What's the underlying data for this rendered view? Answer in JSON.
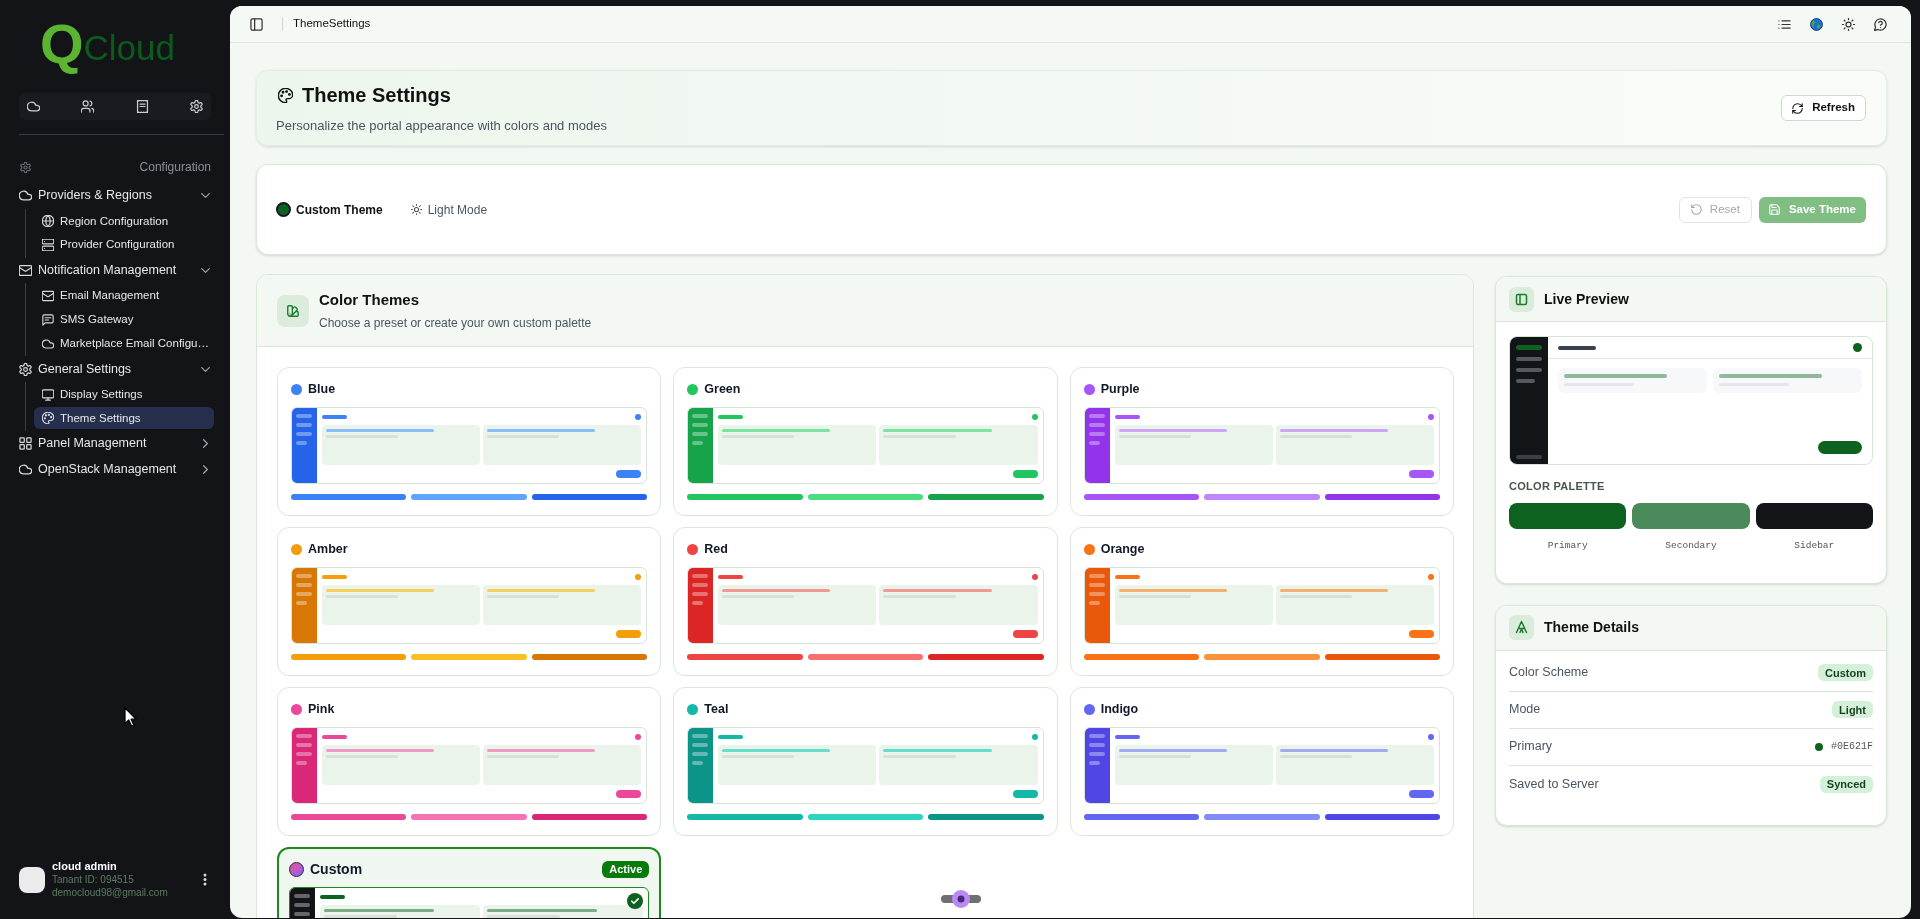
{
  "sidebar": {
    "logo": {
      "mark": "Q",
      "text": "Cloud"
    },
    "section": "Configuration",
    "nav": [
      {
        "label": "Providers & Regions",
        "selected": false,
        "expanded": true,
        "children": [
          {
            "label": "Region Configuration",
            "selected": false
          },
          {
            "label": "Provider Configuration",
            "selected": false
          }
        ]
      },
      {
        "label": "Notification Management",
        "selected": false,
        "expanded": true,
        "children": [
          {
            "label": "Email Management",
            "selected": false
          },
          {
            "label": "SMS Gateway",
            "selected": false
          },
          {
            "label": "Marketplace Email Configu…",
            "selected": false
          }
        ]
      },
      {
        "label": "General Settings",
        "selected": false,
        "expanded": true,
        "children": [
          {
            "label": "Display Settings",
            "selected": false
          },
          {
            "label": "Theme Settings",
            "selected": true
          }
        ]
      },
      {
        "label": "Panel Management",
        "selected": false,
        "expanded": false
      },
      {
        "label": "OpenStack Management",
        "selected": false,
        "expanded": false
      }
    ],
    "user": {
      "name": "cloud admin",
      "tenant": "Tanant ID: 094515",
      "email": "democloud98@gmail.com"
    }
  },
  "header": {
    "breadcrumb": "ThemeSettings"
  },
  "page": {
    "title": "Theme Settings",
    "subtitle": "Personalize the portal appearance with colors and modes",
    "refresh": "Refresh"
  },
  "toolbar": {
    "theme": {
      "label": "Custom Theme",
      "color": "#0e621f"
    },
    "mode": {
      "label": "Light Mode"
    },
    "buttons": [
      {
        "label": "Reset",
        "kind": "reset",
        "disabled": true
      },
      {
        "label": "Save Theme",
        "kind": "save",
        "disabled": true
      }
    ]
  },
  "color_themes": {
    "title": "Color Themes",
    "subtitle": "Choose a preset or create your own custom palette",
    "active_badge": "Active",
    "themes": [
      {
        "name": "Blue",
        "kind": "preset",
        "selected": false,
        "color": "#3b82f6",
        "bars": [
          {
            "color": "#3b82f6"
          },
          {
            "color": "#60a5fa"
          },
          {
            "color": "#2563eb"
          }
        ]
      },
      {
        "name": "Green",
        "kind": "preset",
        "selected": false,
        "color": "#22c55e",
        "bars": [
          {
            "color": "#22c55e"
          },
          {
            "color": "#4ade80"
          },
          {
            "color": "#16a34a"
          }
        ]
      },
      {
        "name": "Purple",
        "kind": "preset",
        "selected": false,
        "color": "#a855f7",
        "bars": [
          {
            "color": "#a855f7"
          },
          {
            "color": "#c084fc"
          },
          {
            "color": "#9333ea"
          }
        ]
      },
      {
        "name": "Amber",
        "kind": "preset",
        "selected": false,
        "color": "#f59e0b",
        "bars": [
          {
            "color": "#f59e0b"
          },
          {
            "color": "#fbbf24"
          },
          {
            "color": "#d97706"
          }
        ]
      },
      {
        "name": "Red",
        "kind": "preset",
        "selected": false,
        "color": "#ef4444",
        "bars": [
          {
            "color": "#ef4444"
          },
          {
            "color": "#f87171"
          },
          {
            "color": "#dc2626"
          }
        ]
      },
      {
        "name": "Orange",
        "kind": "preset",
        "selected": false,
        "color": "#f97316",
        "bars": [
          {
            "color": "#f97316"
          },
          {
            "color": "#fb923c"
          },
          {
            "color": "#ea580c"
          }
        ]
      },
      {
        "name": "Pink",
        "kind": "preset",
        "selected": false,
        "color": "#ec4899",
        "bars": [
          {
            "color": "#ec4899"
          },
          {
            "color": "#f472b6"
          },
          {
            "color": "#db2777"
          }
        ]
      },
      {
        "name": "Teal",
        "kind": "preset",
        "selected": false,
        "color": "#14b8a6",
        "bars": [
          {
            "color": "#14b8a6"
          },
          {
            "color": "#2dd4bf"
          },
          {
            "color": "#0d9488"
          }
        ]
      },
      {
        "name": "Indigo",
        "kind": "preset",
        "selected": false,
        "color": "#6366f1",
        "bars": [
          {
            "color": "#6366f1"
          },
          {
            "color": "#818cf8"
          },
          {
            "color": "#4f46e5"
          }
        ]
      },
      {
        "name": "Custom",
        "kind": "custom",
        "selected": true,
        "color": "#0e621f"
      }
    ]
  },
  "live_preview": {
    "title": "Live Preview",
    "palette_title": "COLOR PALETTE",
    "swatches": [
      {
        "label": "Primary",
        "color": "#0e621f"
      },
      {
        "label": "Secondary",
        "color": "#4b8a5a"
      },
      {
        "label": "Sidebar",
        "color": "#121418"
      }
    ]
  },
  "theme_details": {
    "title": "Theme Details",
    "rows": [
      {
        "label": "Color Scheme",
        "kind": "badge",
        "value": "Custom"
      },
      {
        "label": "Mode",
        "kind": "badge",
        "value": "Light"
      },
      {
        "label": "Primary",
        "kind": "swatch",
        "value": "#0E621F",
        "color": "#0e621f"
      },
      {
        "label": "Saved to Server",
        "kind": "badge",
        "value": "Synced"
      }
    ]
  }
}
